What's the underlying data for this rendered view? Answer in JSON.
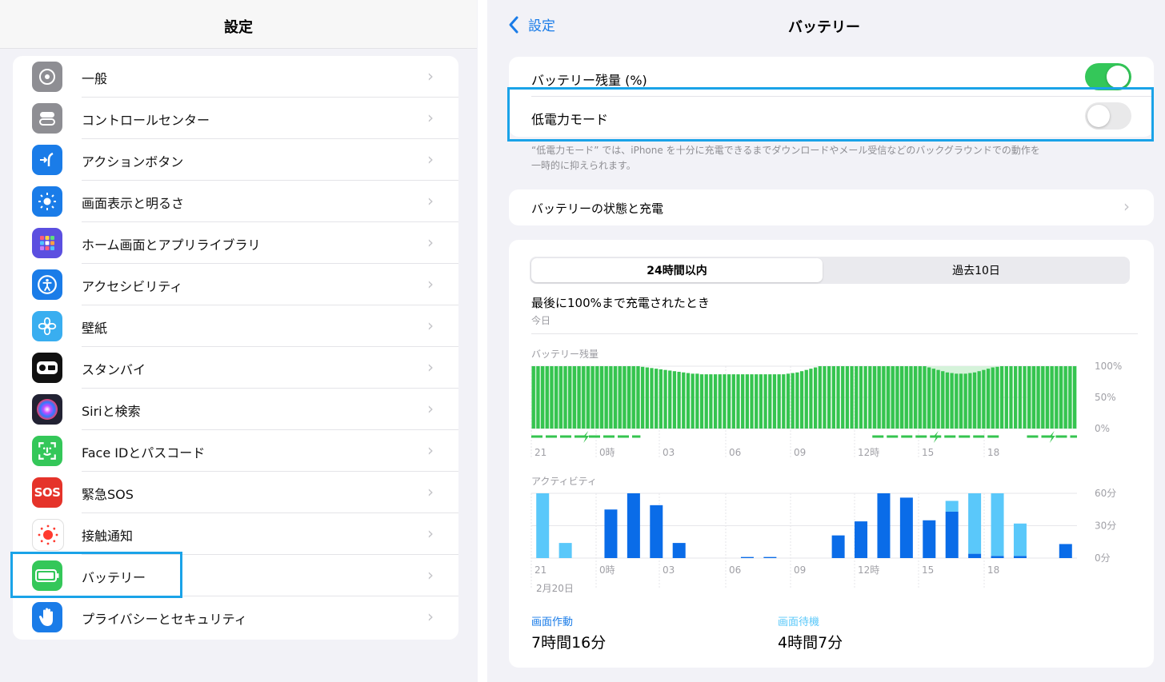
{
  "left": {
    "title": "設定",
    "items": [
      {
        "label": "一般",
        "icon": "gear-icon",
        "color": "#8e8e93"
      },
      {
        "label": "コントロールセンター",
        "icon": "control-center-icon",
        "color": "#8e8e93"
      },
      {
        "label": "アクションボタン",
        "icon": "action-button-icon",
        "color": "#1a7ce8"
      },
      {
        "label": "画面表示と明るさ",
        "icon": "brightness-icon",
        "color": "#1a7ce8"
      },
      {
        "label": "ホーム画面とアプリライブラリ",
        "icon": "home-grid-icon",
        "color": "#5b4fe0"
      },
      {
        "label": "アクセシビリティ",
        "icon": "accessibility-icon",
        "color": "#1a7ce8"
      },
      {
        "label": "壁紙",
        "icon": "wallpaper-flower-icon",
        "color": "#39aef0"
      },
      {
        "label": "スタンバイ",
        "icon": "standby-icon",
        "color": "#111111"
      },
      {
        "label": "Siriと検索",
        "icon": "siri-icon",
        "color": "#222233"
      },
      {
        "label": "Face IDとパスコード",
        "icon": "face-id-icon",
        "color": "#34c759"
      },
      {
        "label": "緊急SOS",
        "icon": "sos-icon",
        "color": "#e5332a",
        "badge": "SOS"
      },
      {
        "label": "接触通知",
        "icon": "exposure-notification-icon",
        "color": "#ffffff"
      },
      {
        "label": "バッテリー",
        "icon": "battery-icon",
        "color": "#34c759"
      },
      {
        "label": "プライバシーとセキュリティ",
        "icon": "privacy-hand-icon",
        "color": "#1a7ce8"
      }
    ]
  },
  "right": {
    "back_label": "設定",
    "title": "バッテリー",
    "toggles": {
      "percentage": {
        "label": "バッテリー残量 (%)",
        "on": true
      },
      "low_power": {
        "label": "低電力モード",
        "on": false
      }
    },
    "low_power_note_1": "“低電力モード” では、iPhone を十分に充電できるまでダウンロードやメール受信などのバックグラウンドでの動作を",
    "low_power_note_2": "一時的に抑えられます。",
    "health_label": "バッテリーの状態と充電",
    "tabs": {
      "active": "24時間以内",
      "inactive": "過去10日"
    },
    "last_charged_label": "最後に100%まで充電されたとき",
    "last_charged_value": "今日",
    "battery_chart_title": "バッテリー残量",
    "activity_chart_title": "アクティビティ",
    "date_label": "2月20日",
    "screen_on_label": "画面作動",
    "screen_on_value": "7時間16分",
    "screen_off_label": "画面待機",
    "screen_off_value": "4時間7分"
  },
  "colors": {
    "accent": "#1a7ce8",
    "green": "#34c759",
    "battery_bar": "#35c44f",
    "activity_dark": "#0a6ce8",
    "activity_light": "#5ac8fa",
    "highlight": "#1aa3e8"
  },
  "chart_data": [
    {
      "type": "bar",
      "title": "バッテリー残量",
      "x_ticks": [
        "21",
        "0時",
        "03",
        "06",
        "09",
        "12時",
        "15",
        "18"
      ],
      "y_ticks": [
        "100%",
        "50%",
        "0%"
      ],
      "ylim": [
        0,
        100
      ],
      "values": [
        100,
        100,
        100,
        100,
        100,
        100,
        100,
        100,
        100,
        100,
        100,
        100,
        100,
        100,
        100,
        100,
        100,
        100,
        100,
        100,
        100,
        100,
        100,
        100,
        99,
        98,
        97,
        96,
        95,
        94,
        93,
        92,
        91,
        90,
        89,
        88,
        88,
        87,
        87,
        87,
        87,
        87,
        87,
        87,
        87,
        87,
        87,
        87,
        87,
        87,
        87,
        87,
        87,
        87,
        87,
        87,
        88,
        89,
        90,
        92,
        94,
        96,
        98,
        100,
        100,
        100,
        100,
        100,
        100,
        100,
        100,
        100,
        100,
        100,
        100,
        100,
        100,
        100,
        100,
        100,
        100,
        100,
        100,
        100,
        100,
        100,
        100,
        98,
        96,
        94,
        92,
        90,
        89,
        88,
        88,
        88,
        89,
        90,
        92,
        94,
        96,
        98,
        99,
        100,
        100,
        100,
        100,
        100,
        100,
        100,
        100,
        100,
        100,
        100,
        100,
        100,
        100,
        100,
        100,
        100
      ],
      "charging_ranges": [
        [
          0,
          24
        ],
        [
          75,
          103
        ],
        [
          109,
          120
        ]
      ]
    },
    {
      "type": "bar",
      "title": "アクティビティ",
      "x_ticks": [
        "21",
        "0時",
        "03",
        "06",
        "09",
        "12時",
        "15",
        "18"
      ],
      "y_ticks": [
        "60分",
        "30分",
        "0分"
      ],
      "ylim": [
        0,
        60
      ],
      "series": [
        {
          "name": "画面作動",
          "values": [
            0,
            0,
            0,
            45,
            60,
            49,
            14,
            0,
            0,
            1,
            1,
            0,
            0,
            21,
            34,
            60,
            56,
            35,
            43,
            4,
            2,
            2,
            0,
            13
          ]
        },
        {
          "name": "画面待機",
          "values": [
            60,
            14,
            0,
            0,
            0,
            0,
            0,
            0,
            0,
            0,
            0,
            0,
            0,
            0,
            0,
            0,
            0,
            0,
            10,
            56,
            58,
            30,
            0,
            0
          ]
        }
      ]
    }
  ]
}
